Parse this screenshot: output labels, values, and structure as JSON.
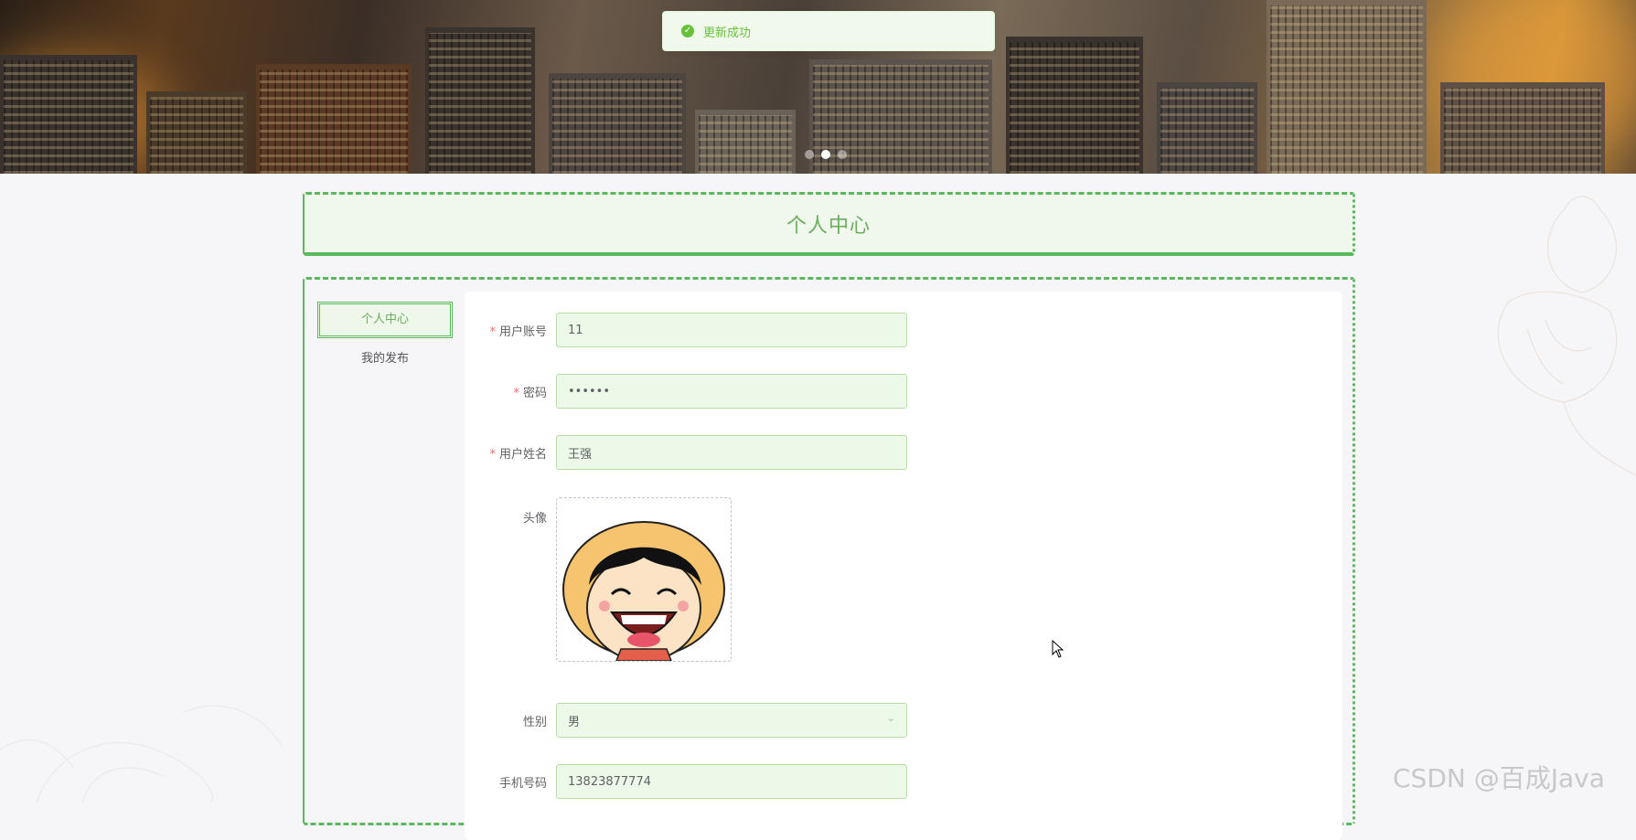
{
  "toast": {
    "icon": "check-circle-icon",
    "message": "更新成功"
  },
  "banner": {
    "slides": 3,
    "active_slide": 2
  },
  "page_title": "个人中心",
  "sidebar": {
    "items": [
      {
        "label": "个人中心",
        "active": true
      },
      {
        "label": "我的发布",
        "active": false
      }
    ]
  },
  "form": {
    "fields": {
      "username": {
        "label": "用户账号",
        "required": true,
        "value": "11"
      },
      "password": {
        "label": "密码",
        "required": true,
        "value": "••••••"
      },
      "realname": {
        "label": "用户姓名",
        "required": true,
        "value": "王强"
      },
      "avatar": {
        "label": "头像",
        "required": false
      },
      "gender": {
        "label": "性别",
        "required": false,
        "value": "男"
      },
      "phone": {
        "label": "手机号码",
        "required": false,
        "value": "13823877774"
      }
    }
  },
  "watermark": "CSDN @百成Java",
  "colors": {
    "accent": "#5cb85c",
    "title": "#6cae5c",
    "success": "#67c23a",
    "input_bg": "#ecf8e8",
    "required": "#f56c6c"
  }
}
